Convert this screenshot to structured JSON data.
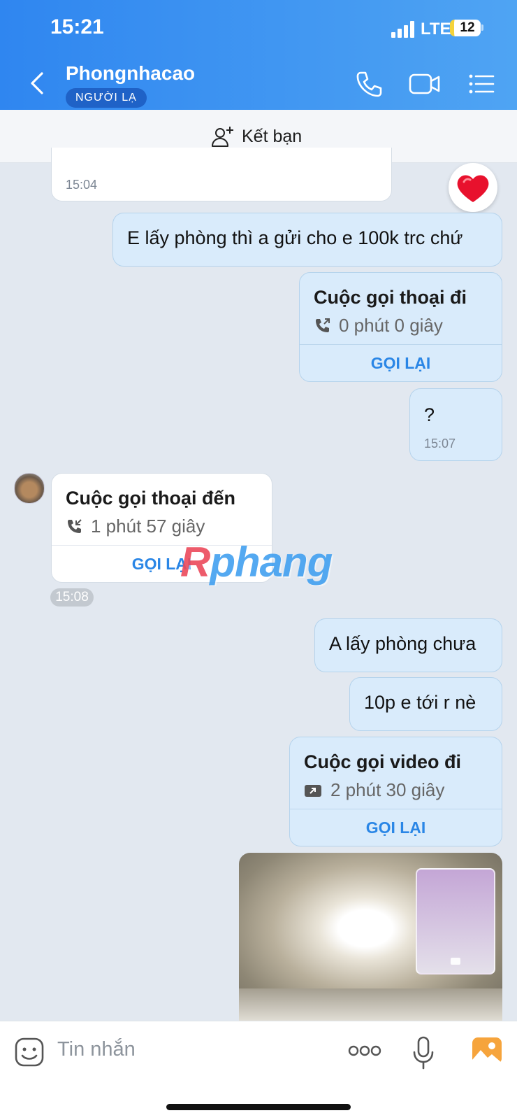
{
  "status_bar": {
    "time": "15:21",
    "network": "LTE",
    "battery": "12"
  },
  "header": {
    "contact_name": "Phongnhacao",
    "badge": "NGƯỜI LẠ",
    "icons": [
      "back-icon",
      "phone-icon",
      "video-camera-icon",
      "menu-icon"
    ]
  },
  "friend_bar": {
    "label": "Kết bạn",
    "icon": "add-friend-icon"
  },
  "messages": {
    "m1": {
      "time": "15:04"
    },
    "m2": {
      "text": "E lấy phòng thì a gửi cho e 100k trc chứ"
    },
    "call1": {
      "title": "Cuộc gọi thoại đi",
      "duration": "0 phút 0 giây",
      "action": "GỌI LẠI"
    },
    "m3": {
      "text": "?",
      "time": "15:07"
    },
    "call2": {
      "title": "Cuộc gọi thoại đến",
      "duration": "1 phút 57 giây",
      "action": "GỌI LẠI",
      "time": "15:08"
    },
    "m4": {
      "text": "A lấy phòng chưa"
    },
    "m5": {
      "text": "10p e tới r nè"
    },
    "call3": {
      "title": "Cuộc gọi video đi",
      "duration": "2 phút 30 giây",
      "action": "GỌI LẠI"
    }
  },
  "reaction": "heart",
  "watermark": {
    "first": "R",
    "rest": "phang"
  },
  "input": {
    "placeholder": "Tin nhắn",
    "icons": [
      "sticker-icon",
      "more-icon",
      "microphone-icon",
      "gallery-icon"
    ]
  }
}
